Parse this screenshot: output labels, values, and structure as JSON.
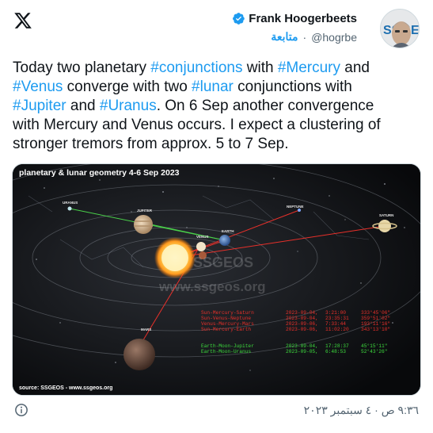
{
  "author": {
    "name": "Frank Hoogerbeets",
    "handle": "@hogrbe",
    "separator": "·",
    "follow_label": "متابعة"
  },
  "tweet": {
    "segments": [
      {
        "text": "Today two planetary ",
        "tag": false
      },
      {
        "text": "#conjunctions",
        "tag": true
      },
      {
        "text": " with ",
        "tag": false
      },
      {
        "text": "#Mercury",
        "tag": true
      },
      {
        "text": " and\n",
        "tag": false
      },
      {
        "text": "#Venus",
        "tag": true
      },
      {
        "text": " converge with two ",
        "tag": false
      },
      {
        "text": "#lunar",
        "tag": true
      },
      {
        "text": " conjunctions with\n",
        "tag": false
      },
      {
        "text": "#Jupiter",
        "tag": true
      },
      {
        "text": " and ",
        "tag": false
      },
      {
        "text": "#Uranus",
        "tag": true
      },
      {
        "text": ". On 6 Sep another convergence\nwith Mercury and Venus occurs. I expect a clustering of\nstronger tremors from approx. 5 to 7 Sep.",
        "tag": false
      }
    ]
  },
  "image": {
    "title": "planetary & lunar geometry 4-6 Sep 2023",
    "watermark": "www.ssgeos.org",
    "watermark_logo": "SSGEOS",
    "source": "source: SSGEOS - www.ssgeos.org",
    "labels": {
      "uranus": "URANUS",
      "jupiter": "JUPITER",
      "neptune": "NEPTUNE",
      "saturn": "SATURN",
      "venus": "VENUS",
      "earth": "EARTH",
      "mars": "MARS"
    },
    "table": [
      {
        "name": "Sun-Mercury-Saturn",
        "date": "2023-09-04,",
        "time": "3:21:00",
        "angle": "333°45'06\"",
        "color": "#e8302a"
      },
      {
        "name": "Sun-Venus-Neptune",
        "date": "2023-09-04,",
        "time": "23:35:31",
        "angle": "359°51'02\"",
        "color": "#e8302a"
      },
      {
        "name": "Venus-Mercury-Mars",
        "date": "2023-09-06,",
        "time": "7:33:44",
        "angle": "193°11'16\"",
        "color": "#e8302a"
      },
      {
        "name": "Sun-Mercury-Earth",
        "date": "2023-09-06,",
        "time": "11:02:20",
        "angle": "343°13'10\"",
        "color": "#e8302a"
      },
      {
        "name": "Earth-Moon-Jupiter",
        "date": "2023-09-04,",
        "time": "17:28:37",
        "angle": "45°15'11\"",
        "color": "#3ddc3d"
      },
      {
        "name": "Earth-Moon-Uranus",
        "date": "2023-09-05,",
        "time": "6:48:53",
        "angle": "52°43'26\"",
        "color": "#3ddc3d"
      }
    ]
  },
  "footer": {
    "timestamp": "٩:٣٦ ص · ٤ سبتمبر ٢٠٢٣"
  }
}
